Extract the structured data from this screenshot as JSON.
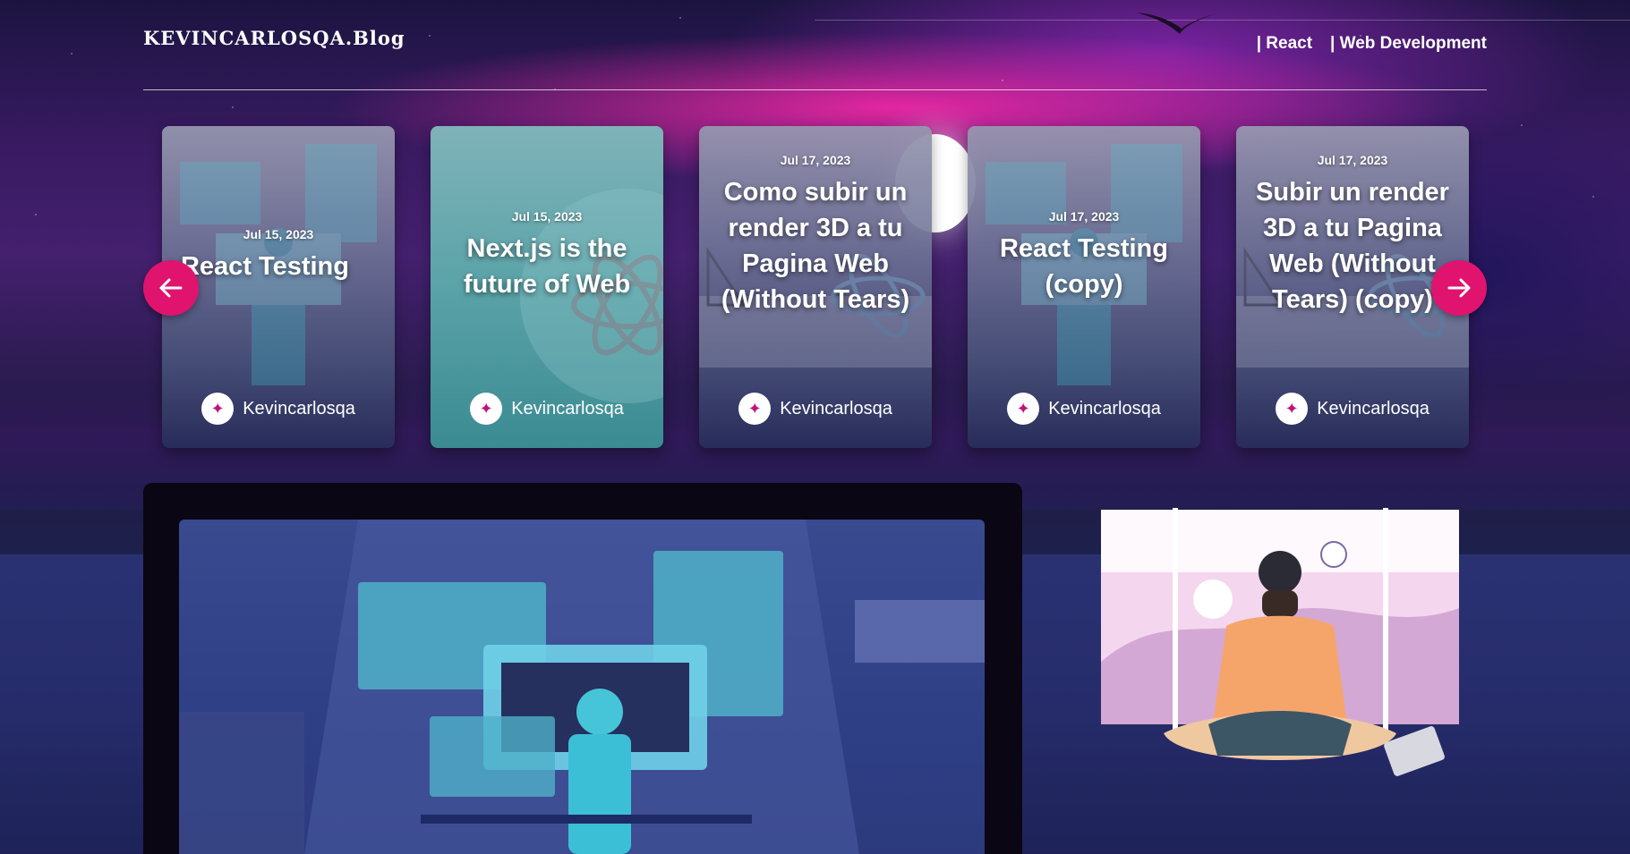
{
  "header": {
    "brand": "KEVINCARLOSQA.Blog",
    "nav": [
      {
        "label": "| React"
      },
      {
        "label": "| Web Development"
      }
    ]
  },
  "carousel": {
    "prev_icon": "arrow-left-icon",
    "next_icon": "arrow-right-icon",
    "accent": "#e0146f",
    "cards": [
      {
        "date": "Jul 15, 2023",
        "title": "React Testing",
        "author": "Kevincarlosqa"
      },
      {
        "date": "Jul 15, 2023",
        "title": "Next.js is the future of Web",
        "author": "Kevincarlosqa"
      },
      {
        "date": "Jul 17, 2023",
        "title": "Como subir un render 3D a tu Pagina Web (Without Tears)",
        "author": "Kevincarlosqa"
      },
      {
        "date": "Jul 17, 2023",
        "title": "React Testing (copy)",
        "author": "Kevincarlosqa"
      },
      {
        "date": "Jul 17, 2023",
        "title": "Subir un render 3D a tu Pagina Web (Without Tears) (copy)",
        "author": "Kevincarlosqa"
      }
    ]
  },
  "featured": {
    "image_icon": "developer-illustration"
  },
  "sidebar": {
    "image_icon": "meditation-illustration"
  }
}
